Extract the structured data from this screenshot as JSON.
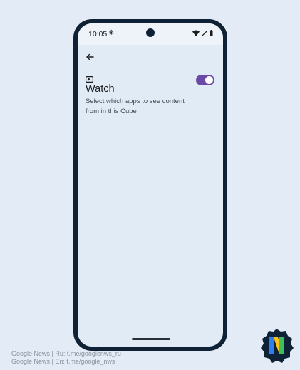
{
  "status_bar": {
    "time": "10:05",
    "snow_glyph": "❄"
  },
  "icons": {
    "back": "arrow-left-icon",
    "watch": "play-in-box-icon",
    "wifi": "wifi-icon",
    "signal": "cell-signal-icon",
    "battery": "battery-icon"
  },
  "setting": {
    "title": "Watch",
    "description": "Select which apps to see content from in this Cube",
    "enabled": true
  },
  "colors": {
    "toggle_on": "#6a4aa6",
    "frame": "#0f2235",
    "background": "#e3ecf6"
  },
  "credits": {
    "line1": "Google News | Ru: t.me/googlenws_ru",
    "line2": "Google News | En: t.me/google_nws"
  }
}
